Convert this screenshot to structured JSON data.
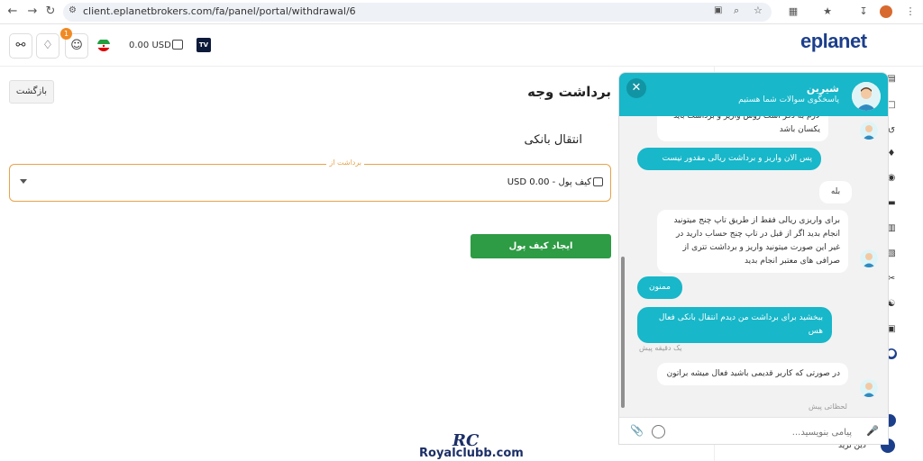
{
  "browser": {
    "url": "client.eplanetbrokers.com/fa/panel/portal/withdrawal/6"
  },
  "header": {
    "notification_count": "1",
    "balance": "0.00 USD",
    "tv_label": "TV"
  },
  "logo": {
    "text": "eplanet"
  },
  "main": {
    "back_label": "بازگشت",
    "page_title": "برداشت وجه",
    "section_title": "انتقال بانکی",
    "select_legend": "برداشت از",
    "select_value": "کیف پول   -   USD 0.00",
    "create_button": "ایجاد کیف پول"
  },
  "watermark": {
    "mark": "RC",
    "text": "Royalclubb.com"
  },
  "sidebar": {
    "bottom_label": "دین ترید"
  },
  "chat": {
    "agent_name": "شیرین",
    "agent_subtitle": "پاسخگوی سوالات شما هستیم",
    "input_placeholder": "پیامی بنویسید...",
    "messages": [
      {
        "from": "agent",
        "text": "لازم به ذکر است روش واریز و برداشت باید یکسان باشد"
      },
      {
        "from": "user",
        "text": "پس الان واریز و برداشت ریالی مقدور نیست"
      },
      {
        "from": "agent",
        "text": "بله"
      },
      {
        "from": "agent",
        "text": "برای واریزی ریالی فقط از طریق تاپ چنج میتونید انجام بدید اگر از قبل در تاپ چنج حساب دارید در غیر این صورت میتونید واریز و برداشت تتری از صرافی های معتبر انجام بدید"
      },
      {
        "from": "user",
        "text": "ممنون"
      },
      {
        "from": "user",
        "text": "ببخشید برای برداشت من دیدم انتقال بانکی فعال هس"
      },
      {
        "from": "agent",
        "text": "در صورتی که کاربر قدیمی باشید فعال میشه براتون"
      }
    ],
    "timestamps": [
      "یک دقیقه پیش",
      "لحظاتی پیش"
    ]
  },
  "colors": {
    "chat_accent": "#18b7c9",
    "create_button": "#2e9b45",
    "select_border": "#e7a34a",
    "logo": "#1c3f8c"
  }
}
